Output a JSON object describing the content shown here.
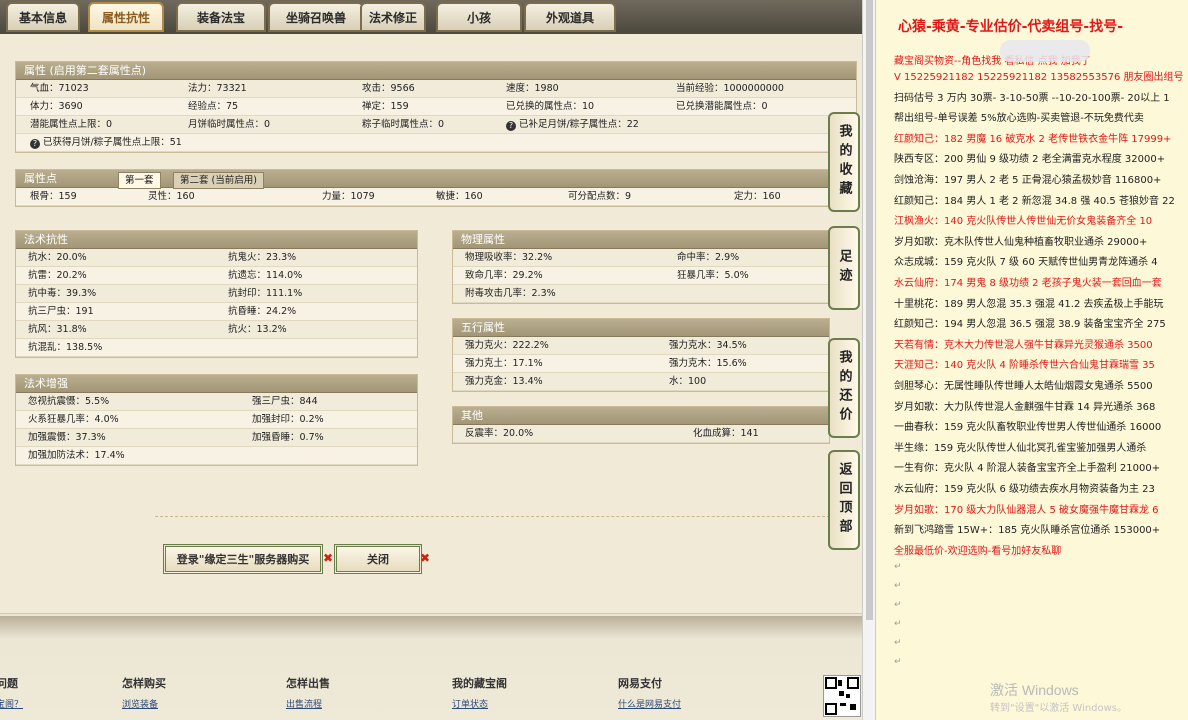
{
  "tabs": [
    "基本信息",
    "属性抗性",
    "装备法宝",
    "坐骑召唤兽",
    "法术修正",
    "小孩",
    "外观道具"
  ],
  "attr": {
    "title": "属性 (启用第二套属性点)",
    "rows": [
      [
        "气血：71023",
        "法力：73321",
        "攻击：9566",
        "速度：1980",
        "当前经验：1000000000"
      ],
      [
        "体力：3690",
        "经验点：75",
        "禅定：159",
        "已兑换的属性点：10",
        "已兑换潜能属性点：0"
      ],
      [
        "潜能属性点上限：0",
        "月饼临时属性点：0",
        "粽子临时属性点：0",
        "已补足月饼/粽子属性点：22",
        ""
      ],
      [
        "已获得月饼/粽子属性点上限：51",
        "",
        "",
        "",
        ""
      ]
    ]
  },
  "points": {
    "title": "属性点",
    "tab1": "第一套",
    "tab2": "第二套 (当前启用)",
    "row": [
      "根骨：159",
      "灵性：160",
      "力量：1079",
      "敏捷：160",
      "可分配点数：9",
      "定力：160"
    ]
  },
  "resist": {
    "title": "法术抗性",
    "rows": [
      [
        "抗水：20.0%",
        "抗鬼火：23.3%"
      ],
      [
        "抗雷：20.2%",
        "抗遗忘：114.0%"
      ],
      [
        "抗中毒：39.3%",
        "抗封印：111.1%"
      ],
      [
        "抗三尸虫：191",
        "抗昏睡：24.2%"
      ],
      [
        "抗风：31.8%",
        "抗火：13.2%"
      ],
      [
        "抗混乱：138.5%",
        ""
      ]
    ]
  },
  "boost": {
    "title": "法术增强",
    "rows": [
      [
        "忽视抗震慑：5.5%",
        "强三尸虫：844"
      ],
      [
        "火系狂暴几率：4.0%",
        "加强封印：0.2%"
      ],
      [
        "加强震慑：37.3%",
        "加强昏睡：0.7%"
      ],
      [
        "加强加防法术：17.4%",
        ""
      ]
    ]
  },
  "phys": {
    "title": "物理属性",
    "rows": [
      [
        "物理吸收率：32.2%",
        "命中率：2.9%"
      ],
      [
        "致命几率：29.2%",
        "狂暴几率：5.0%"
      ],
      [
        "附毒攻击几率：2.3%",
        ""
      ]
    ]
  },
  "wuxing": {
    "title": "五行属性",
    "rows": [
      [
        "强力克火：222.2%",
        "强力克水：34.5%"
      ],
      [
        "强力克土：17.1%",
        "强力克木：15.6%"
      ],
      [
        "强力克金：13.4%",
        "水：100"
      ]
    ]
  },
  "other": {
    "title": "其他",
    "rows": [
      [
        "反震率：20.0%",
        "化血成算：141"
      ]
    ]
  },
  "buttons": {
    "buy": "登录\"缘定三生\"服务器购买",
    "close": "关闭"
  },
  "side": [
    "我的收藏",
    "足迹",
    "我的还价",
    "返回顶部"
  ],
  "footer": {
    "heads": [
      "问题",
      "怎样购买",
      "怎样出售",
      "我的藏宝阁",
      "网易支付"
    ],
    "links": [
      "宝阁？",
      "浏览装备",
      "出售流程",
      "订单状态",
      "什么是网易支付"
    ]
  },
  "notes": {
    "title": "心猿-乘黄-专业估价-代卖组号-找号-",
    "lines": [
      {
        "t": "藏宝阁买物资--角色找我 看私信 点我 加我了",
        "c": "red"
      },
      {
        "t": "V 15225921182 15225921182 13582553576 朋友圈出组号",
        "c": "red"
      },
      {
        "t": "扫码估号 3 万内 30票- 3-10-50票  --10-20-100票- 20以上 1",
        "c": "n"
      },
      {
        "t": "帮出组号-单号误差 5%放心选购-买卖管退-不玩免费代卖",
        "c": "n"
      },
      {
        "t": "红颜知己：182 男魔 16 破克水 2 老传世铁衣金牛阵 17999+",
        "c": "red"
      },
      {
        "t": "陕西专区：200 男仙 9 级功绩 2 老全满雷克水程度 32000+",
        "c": "n"
      },
      {
        "t": "剑蚀沧海：197 男人 2 老 5 正骨混心猿孟极妙音 116800+",
        "c": "n"
      },
      {
        "t": "红颜知己：184 男人 1 老 2 新忽混 34.8 强 40.5 苍狼妙音 22",
        "c": "n"
      },
      {
        "t": "江枫渔火：140 克火队传世人传世仙无价女鬼装备齐全 10",
        "c": "red"
      },
      {
        "t": "岁月如歌：克木队传世人仙鬼种植畜牧职业通杀 29000+",
        "c": "n"
      },
      {
        "t": "众志成城：159 克火队 7 级 60 天赋传世仙男青龙阵通杀 4",
        "c": "n"
      },
      {
        "t": "水云仙府：174 男鬼 8 级功绩 2 老孩子鬼火装一套回血一套",
        "c": "red"
      },
      {
        "t": "十里桃花：189 男人忽混 35.3 强混 41.2 去疾孟极上手能玩",
        "c": "n"
      },
      {
        "t": "红颜知己：194 男人忽混 36.5 强混 38.9 装备宝宝齐全 275",
        "c": "n"
      },
      {
        "t": "天若有情：克木大力传世混人强牛甘霖异光灵猴通杀 3500",
        "c": "red"
      },
      {
        "t": "天涯知己：140 克火队 4 阶睡杀传世六合仙鬼甘霖瑞雪 35",
        "c": "red"
      },
      {
        "t": "剑胆琴心：无属性睡队传世睡人太皓仙烟霞女鬼通杀 5500",
        "c": "n"
      },
      {
        "t": "岁月如歌：大力队传世混人金麒强牛甘霖 14 异光通杀 368",
        "c": "n"
      },
      {
        "t": "一曲春秋：159 克火队畜牧职业传世男人传世仙通杀 16000",
        "c": "n"
      },
      {
        "t": "半生缘：159 克火队传世人仙北冥孔雀宝鉴加强男人通杀",
        "c": "n"
      },
      {
        "t": "一生有你：克火队 4 阶混人装备宝宝齐全上手盈利 21000+",
        "c": "n"
      },
      {
        "t": "水云仙府：159 克火队 6 级功绩去疾水月物资装备为主 23",
        "c": "n"
      },
      {
        "t": "岁月如歌：170 级大力队仙器混人 5 破女魔强牛魔甘霖龙 6",
        "c": "red"
      },
      {
        "t": "新到飞鸿踏雪 15W+：185 克火队睡杀宫位通杀 153000+",
        "c": "n"
      },
      {
        "t": "全服最低价-欢迎选购-看号加好友私聊",
        "c": "red"
      }
    ]
  },
  "watermark": {
    "l1": "激活 Windows",
    "l2": "转到\"设置\"以激活 Windows。"
  }
}
